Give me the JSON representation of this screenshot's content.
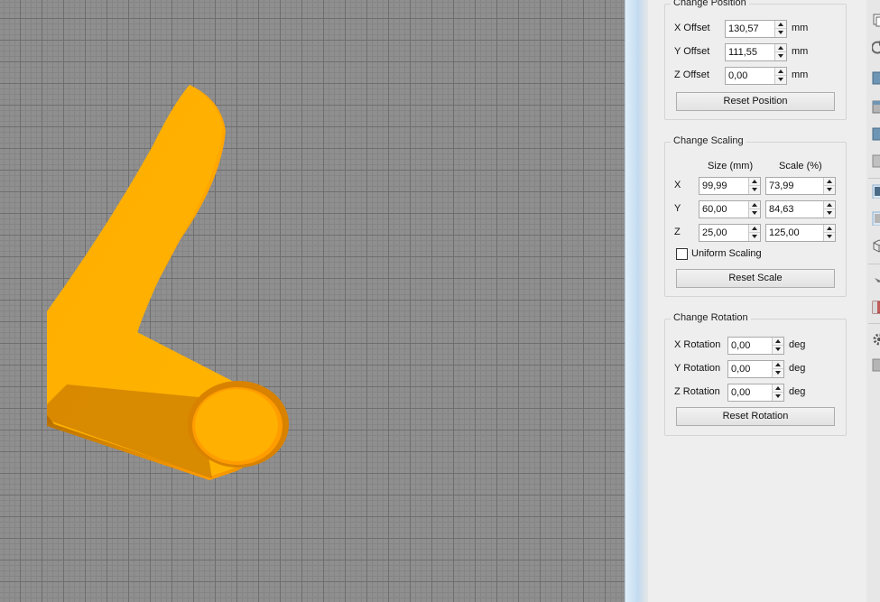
{
  "position": {
    "title": "Change Position",
    "x_label": "X Offset",
    "x_value": "130,57",
    "x_unit": "mm",
    "y_label": "Y Offset",
    "y_value": "111,55",
    "y_unit": "mm",
    "z_label": "Z Offset",
    "z_value": "0,00",
    "z_unit": "mm",
    "reset_label": "Reset Position"
  },
  "scaling": {
    "title": "Change Scaling",
    "size_header": "Size (mm)",
    "scale_header": "Scale (%)",
    "rows": [
      {
        "axis": "X",
        "size": "99,99",
        "scale": "73,99"
      },
      {
        "axis": "Y",
        "size": "60,00",
        "scale": "84,63"
      },
      {
        "axis": "Z",
        "size": "25,00",
        "scale": "125,00"
      }
    ],
    "uniform_label": "Uniform Scaling",
    "uniform_checked": false,
    "reset_label": "Reset Scale"
  },
  "rotation": {
    "title": "Change Rotation",
    "x_label": "X Rotation",
    "x_value": "0,00",
    "x_unit": "deg",
    "y_label": "Y Rotation",
    "y_value": "0,00",
    "y_unit": "deg",
    "z_label": "Z Rotation",
    "z_value": "0,00",
    "z_unit": "deg",
    "reset_label": "Reset Rotation"
  },
  "colors": {
    "model_main": "#ffb000",
    "model_shadow": "#b86a00",
    "grid_background": "#8f8f8f",
    "panel_background": "#eeeeee"
  },
  "toolbar_icons": [
    "copy-icon",
    "rotate-icon",
    "view-front-icon",
    "view-top-icon",
    "view-side-icon",
    "view-iso-icon",
    "view-selected-icon",
    "view-perspective-icon",
    "wireframe-icon",
    "pointer-icon",
    "cut-icon",
    "settings-icon",
    "object-icon"
  ]
}
